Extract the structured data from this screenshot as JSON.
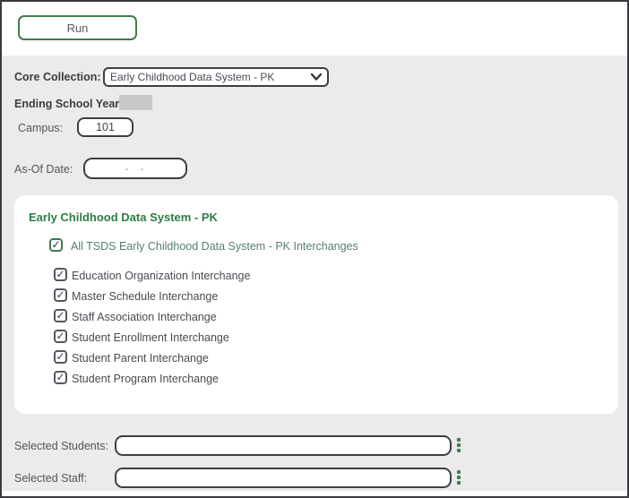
{
  "toolbar": {
    "run_label": "Run"
  },
  "form": {
    "core_collection": {
      "label": "Core Collection:",
      "value": "Early Childhood Data System - PK"
    },
    "ending_school_year": {
      "label": "Ending School Year:"
    },
    "campus": {
      "label": "Campus:",
      "value": "101"
    },
    "as_of_date": {
      "label": "As-Of Date:",
      "placeholder": "-  -"
    }
  },
  "panel": {
    "heading": "Early Childhood Data System - PK",
    "all_checkbox": {
      "label": "All TSDS Early Childhood Data System - PK Interchanges",
      "checked": true
    },
    "interchanges": [
      {
        "label": "Education Organization Interchange",
        "checked": true
      },
      {
        "label": "Master Schedule Interchange",
        "checked": true
      },
      {
        "label": "Staff Association Interchange",
        "checked": true
      },
      {
        "label": "Student Enrollment Interchange",
        "checked": true
      },
      {
        "label": "Student Parent Interchange",
        "checked": true
      },
      {
        "label": "Student Program Interchange",
        "checked": true
      }
    ]
  },
  "footer": {
    "selected_students": {
      "label": "Selected Students:",
      "value": ""
    },
    "selected_staff": {
      "label": "Selected Staff:",
      "value": ""
    }
  },
  "icons": {
    "select_arrow": "chevron-down-icon",
    "field_menu": "vertical-ellipsis-icon",
    "checkbox_mark": "checkmark-icon"
  },
  "colors": {
    "accent_green": "#3e7d4b",
    "heading_green": "#2d7d46",
    "teal_label": "#54806d",
    "page_gray": "#ebebeb",
    "border_dark": "#3e3e44",
    "redacted_gray": "#c8c8c8"
  }
}
